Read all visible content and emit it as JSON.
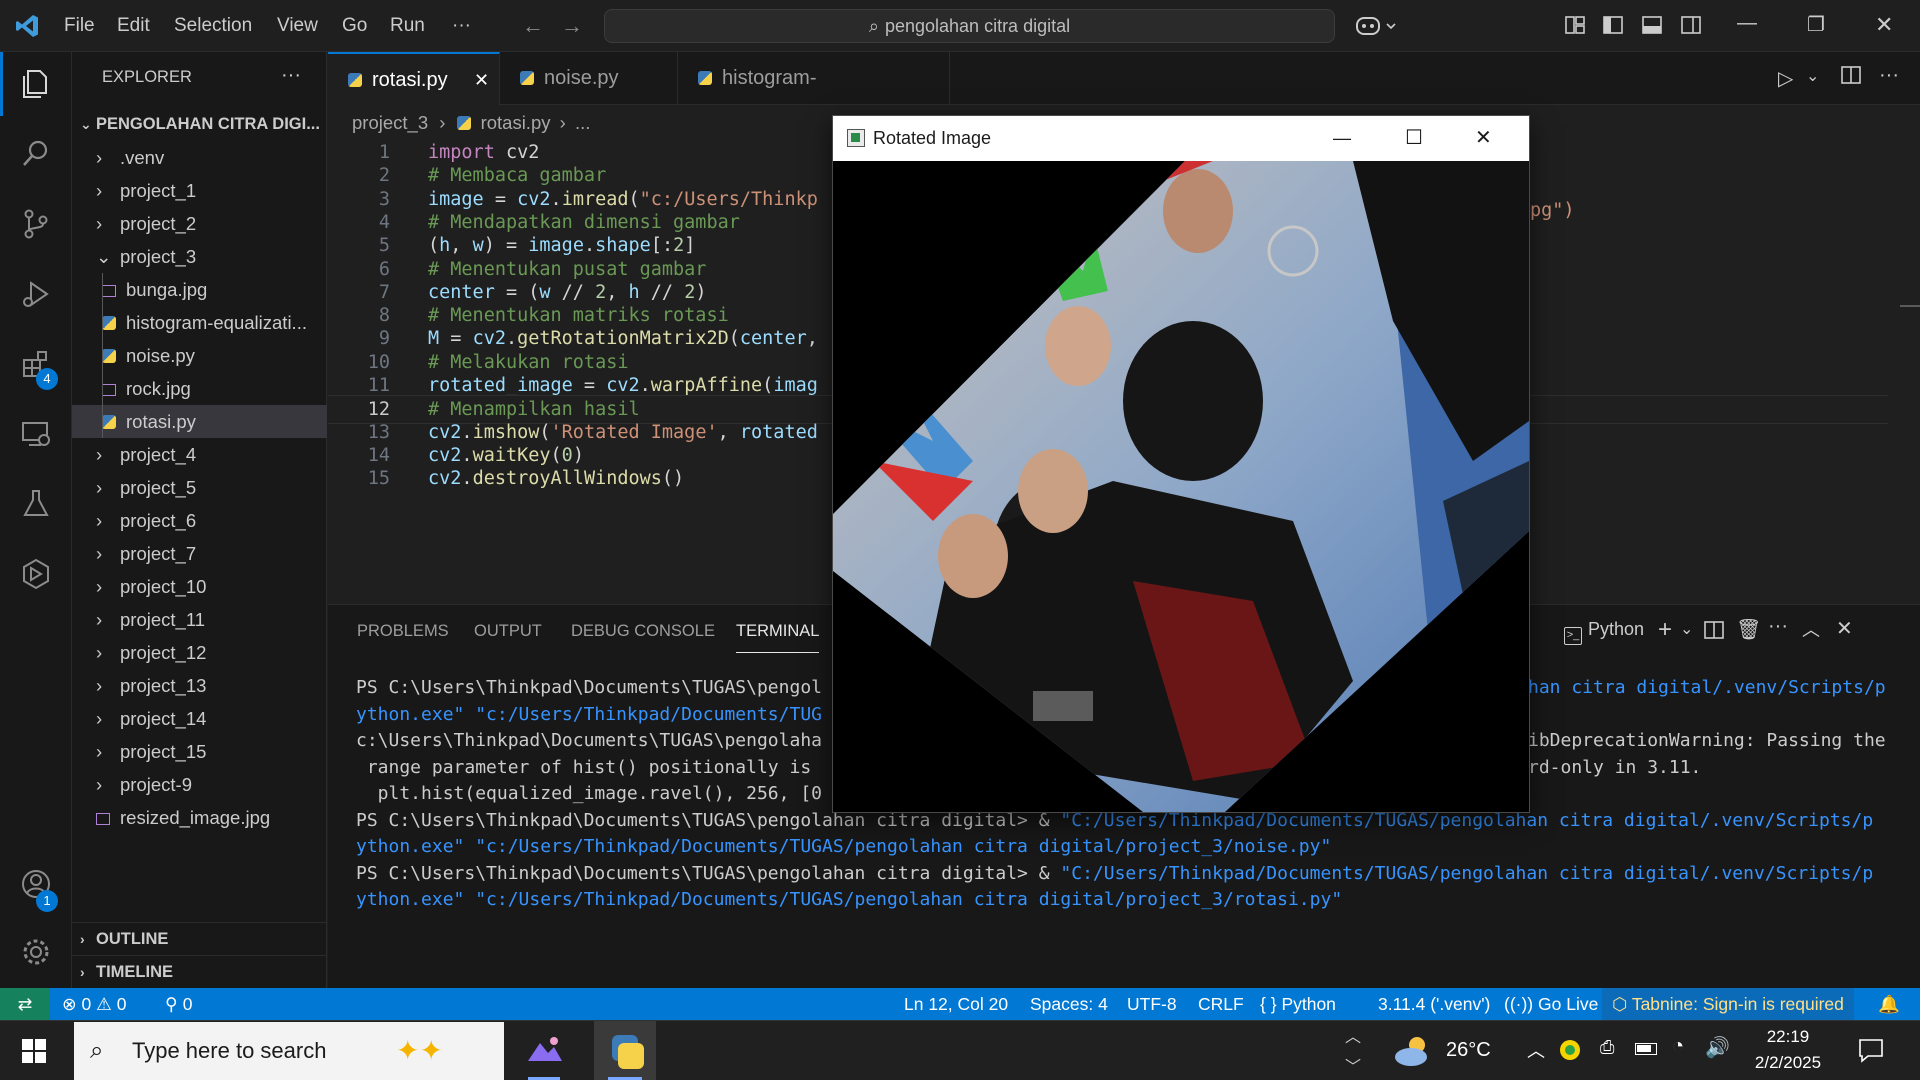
{
  "titlebar": {
    "menus": [
      "File",
      "Edit",
      "Selection",
      "View",
      "Go",
      "Run",
      "···"
    ],
    "search_text": "pengolahan citra digital"
  },
  "activitybar": {
    "extensions_badge": "4",
    "accounts_badge": "1"
  },
  "sidebar": {
    "title": "EXPLORER",
    "more": "···",
    "root": "PENGOLAHAN CITRA DIGI...",
    "items": [
      {
        "label": ".venv",
        "kind": "folder",
        "expanded": false
      },
      {
        "label": "project_1",
        "kind": "folder",
        "expanded": false
      },
      {
        "label": "project_2",
        "kind": "folder",
        "expanded": false
      },
      {
        "label": "project_3",
        "kind": "folder",
        "expanded": true
      },
      {
        "label": "bunga.jpg",
        "kind": "image"
      },
      {
        "label": "histogram-equalizati...",
        "kind": "python"
      },
      {
        "label": "noise.py",
        "kind": "python"
      },
      {
        "label": "rock.jpg",
        "kind": "image"
      },
      {
        "label": "rotasi.py",
        "kind": "python",
        "selected": true
      },
      {
        "label": "project_4",
        "kind": "folder",
        "expanded": false
      },
      {
        "label": "project_5",
        "kind": "folder",
        "expanded": false
      },
      {
        "label": "project_6",
        "kind": "folder",
        "expanded": false
      },
      {
        "label": "project_7",
        "kind": "folder",
        "expanded": false
      },
      {
        "label": "project_10",
        "kind": "folder",
        "expanded": false
      },
      {
        "label": "project_11",
        "kind": "folder",
        "expanded": false
      },
      {
        "label": "project_12",
        "kind": "folder",
        "expanded": false
      },
      {
        "label": "project_13",
        "kind": "folder",
        "expanded": false
      },
      {
        "label": "project_14",
        "kind": "folder",
        "expanded": false
      },
      {
        "label": "project_15",
        "kind": "folder",
        "expanded": false
      },
      {
        "label": "project-9",
        "kind": "folder",
        "expanded": false
      },
      {
        "label": "resized_image.jpg",
        "kind": "image"
      }
    ],
    "outline": "OUTLINE",
    "timeline": "TIMELINE"
  },
  "tabs": [
    {
      "label": "rotasi.py",
      "active": true,
      "close": "✕"
    },
    {
      "label": "noise.py",
      "active": false
    },
    {
      "label": "histogram-equalization.py",
      "active": false
    }
  ],
  "breadcrumb": {
    "folder": "project_3",
    "file": "rotasi.py",
    "more": "..."
  },
  "editor": {
    "current_line": 12,
    "lines": [
      {
        "n": "1",
        "tokens": [
          [
            "kw",
            "import "
          ],
          [
            "pl",
            "cv2"
          ]
        ]
      },
      {
        "n": "2",
        "tokens": [
          [
            "cm",
            "# Membaca gambar"
          ]
        ]
      },
      {
        "n": "3",
        "tokens": [
          [
            "var",
            "image"
          ],
          [
            "pl",
            " = "
          ],
          [
            "var",
            "cv2"
          ],
          [
            "pl",
            "."
          ],
          [
            "fn",
            "imread"
          ],
          [
            "pl",
            "("
          ],
          [
            "str",
            "\"c:/Users/Thinkp"
          ]
        ]
      },
      {
        "n": "4",
        "tokens": [
          [
            "cm",
            "# Mendapatkan dimensi gambar"
          ]
        ]
      },
      {
        "n": "5",
        "tokens": [
          [
            "pl",
            "("
          ],
          [
            "var",
            "h"
          ],
          [
            "pl",
            ", "
          ],
          [
            "var",
            "w"
          ],
          [
            "pl",
            ") = "
          ],
          [
            "var",
            "image"
          ],
          [
            "pl",
            "."
          ],
          [
            "var",
            "shape"
          ],
          [
            "pl",
            "[:"
          ],
          [
            "num",
            "2"
          ],
          [
            "pl",
            "]"
          ]
        ]
      },
      {
        "n": "6",
        "tokens": [
          [
            "cm",
            "# Menentukan pusat gambar"
          ]
        ]
      },
      {
        "n": "7",
        "tokens": [
          [
            "var",
            "center"
          ],
          [
            "pl",
            " = ("
          ],
          [
            "var",
            "w"
          ],
          [
            "pl",
            " // "
          ],
          [
            "num",
            "2"
          ],
          [
            "pl",
            ", "
          ],
          [
            "var",
            "h"
          ],
          [
            "pl",
            " // "
          ],
          [
            "num",
            "2"
          ],
          [
            "pl",
            ")"
          ]
        ]
      },
      {
        "n": "8",
        "tokens": [
          [
            "cm",
            "# Menentukan matriks rotasi"
          ]
        ]
      },
      {
        "n": "9",
        "tokens": [
          [
            "var",
            "M"
          ],
          [
            "pl",
            " = "
          ],
          [
            "var",
            "cv2"
          ],
          [
            "pl",
            "."
          ],
          [
            "fn",
            "getRotationMatrix2D"
          ],
          [
            "pl",
            "("
          ],
          [
            "var",
            "center"
          ],
          [
            "pl",
            ","
          ]
        ]
      },
      {
        "n": "10",
        "tokens": [
          [
            "cm",
            "# Melakukan rotasi"
          ]
        ]
      },
      {
        "n": "11",
        "tokens": [
          [
            "var",
            "rotated_image"
          ],
          [
            "pl",
            " = "
          ],
          [
            "var",
            "cv2"
          ],
          [
            "pl",
            "."
          ],
          [
            "fn",
            "warpAffine"
          ],
          [
            "pl",
            "("
          ],
          [
            "var",
            "imag"
          ]
        ]
      },
      {
        "n": "12",
        "tokens": [
          [
            "cm",
            "# Menampilkan hasil"
          ]
        ]
      },
      {
        "n": "13",
        "tokens": [
          [
            "var",
            "cv2"
          ],
          [
            "pl",
            "."
          ],
          [
            "fn",
            "imshow"
          ],
          [
            "pl",
            "("
          ],
          [
            "str",
            "'Rotated Image'"
          ],
          [
            "pl",
            ", "
          ],
          [
            "var",
            "rotated"
          ]
        ]
      },
      {
        "n": "14",
        "tokens": [
          [
            "var",
            "cv2"
          ],
          [
            "pl",
            "."
          ],
          [
            "fn",
            "waitKey"
          ],
          [
            "pl",
            "("
          ],
          [
            "num",
            "0"
          ],
          [
            "pl",
            ")"
          ]
        ]
      },
      {
        "n": "15",
        "tokens": [
          [
            "var",
            "cv2"
          ],
          [
            "pl",
            "."
          ],
          [
            "fn",
            "destroyAllWindows"
          ],
          [
            "pl",
            "()"
          ]
        ]
      }
    ],
    "line3_tail": "pg\")"
  },
  "panel": {
    "tabs": [
      "PROBLEMS",
      "OUTPUT",
      "DEBUG CONSOLE",
      "TERMINAL"
    ],
    "active_tab": "TERMINAL",
    "shell": "Python",
    "terminal_left": [
      [
        [
          "p",
          "PS C:\\Users\\Thinkpad\\Documents\\TUGAS\\pengol"
        ]
      ],
      [
        [
          "l",
          "ython.exe\" \"c:/Users/Thinkpad/Documents/TUG"
        ]
      ],
      [
        [
          "p",
          "c:\\Users\\Thinkpad\\Documents\\TUGAS\\pengolaha"
        ]
      ],
      [
        [
          "p",
          " range parameter of hist() positionally is "
        ]
      ],
      [
        [
          "p",
          "  plt.hist(equalized_image.ravel(), 256, [0"
        ]
      ],
      [
        [
          "p",
          "PS C:\\Users\\Thinkpad\\Documents\\TUGAS\\pengolahan citra digital> & "
        ],
        [
          "l",
          "\"C:/Users/Thinkpad/Documents/TUGAS/pengolahan citra digital/.venv/Scripts/p"
        ]
      ],
      [
        [
          "l",
          "ython.exe\" \"c:/Users/Thinkpad/Documents/TUGAS/pengolahan citra digital/project_3/noise.py\""
        ]
      ],
      [
        [
          "p",
          "PS C:\\Users\\Thinkpad\\Documents\\TUGAS\\pengolahan citra digital> & "
        ],
        [
          "l",
          "\"C:/Users/Thinkpad/Documents/TUGAS/pengolahan citra digital/.venv/Scripts/p"
        ]
      ],
      [
        [
          "l",
          "ython.exe\" \"c:/Users/Thinkpad/Documents/TUGAS/pengolahan citra digital/project_3/rotasi.py\""
        ]
      ]
    ],
    "terminal_right": [
      [
        [
          "l",
          "han citra digital/.venv/Scripts/p"
        ]
      ],
      [
        [
          "p",
          ""
        ]
      ],
      [
        [
          "p",
          "ibDeprecationWarning: Passing the"
        ]
      ],
      [
        [
          "p",
          "rd-only in 3.11."
        ]
      ]
    ]
  },
  "image_window": {
    "title": "Rotated Image",
    "minimize": "—",
    "maximize": "☐",
    "close": "✕"
  },
  "statusbar": {
    "errors": "0",
    "warnings": "0",
    "ports": "0",
    "position": "Ln 12, Col 20",
    "spaces": "Spaces: 4",
    "encoding": "UTF-8",
    "eol": "CRLF",
    "language": "Python",
    "interpreter": "3.11.4 ('.venv')",
    "golive": "Go Live",
    "tabnine": "Tabnine: Sign-in is required"
  },
  "taskbar": {
    "search_placeholder": "Type here to search",
    "temperature": "26°C",
    "time": "22:19",
    "date": "2/2/2025"
  },
  "colors": {
    "accent": "#0078d4",
    "statusbar": "#0078d4",
    "editor_bg": "#1f1f1f",
    "sidebar_bg": "#181818"
  }
}
